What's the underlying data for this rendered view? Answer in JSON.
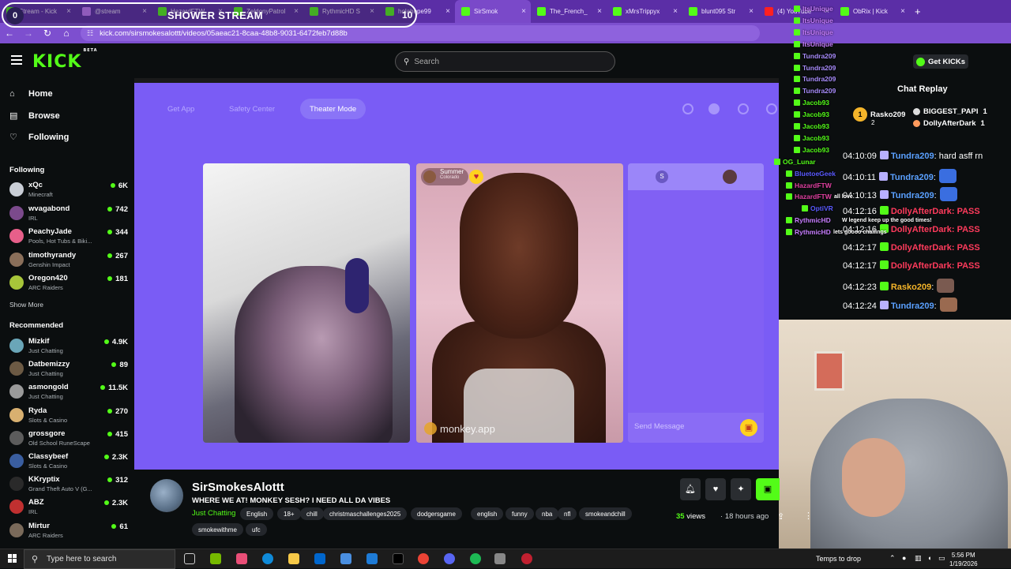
{
  "browser": {
    "tabs": [
      {
        "label": "Stream - Kick",
        "color": "#53fc18"
      },
      {
        "label": "@stream",
        "color": "#c77dff"
      },
      {
        "label": "HazardFTW",
        "color": "#53fc18"
      },
      {
        "label": "ZeldonyPatrol",
        "color": "#53fc18"
      },
      {
        "label": "RythmicHD S",
        "color": "#53fc18"
      },
      {
        "label": "holahope99",
        "color": "#53fc18"
      },
      {
        "label": "SirSmok",
        "color": "#53fc18",
        "active": true
      },
      {
        "label": "The_French_",
        "color": "#53fc18"
      },
      {
        "label": "xMrsTrippyx",
        "color": "#53fc18"
      },
      {
        "label": "blunt095 Str",
        "color": "#53fc18"
      },
      {
        "label": "(4) YouTube",
        "color": "#ff2020"
      },
      {
        "label": "ObRix | Kick",
        "color": "#53fc18"
      }
    ],
    "url": "kick.com/sirsmokesalottt/videos/05aeac21-8caa-48b8-9031-6472feb7d88b"
  },
  "overlay": {
    "count": "0",
    "title": "SHOWER STREAM",
    "number": "10"
  },
  "header": {
    "logo": "KICK",
    "logo_sup": "BETA",
    "search_placeholder": "Search",
    "get_kicks": "Get KICKs"
  },
  "sidebar": {
    "nav": [
      {
        "label": "Home",
        "icon": "home-icon",
        "glyph": "⌂"
      },
      {
        "label": "Browse",
        "icon": "browse-icon",
        "glyph": "▤"
      },
      {
        "label": "Following",
        "icon": "heart-icon",
        "glyph": "♡"
      }
    ],
    "following_title": "Following",
    "following": [
      {
        "name": "xQc",
        "category": "Minecraft",
        "viewers": "6K",
        "color": "#c9ced6"
      },
      {
        "name": "wvagabond",
        "category": "IRL",
        "viewers": "742",
        "color": "#7b4a8c"
      },
      {
        "name": "PeachyJade",
        "category": "Pools, Hot Tubs & Biki...",
        "viewers": "344",
        "color": "#e75f8a"
      },
      {
        "name": "timothyrandy",
        "category": "Genshin Impact",
        "viewers": "267",
        "color": "#8a6f5a"
      },
      {
        "name": "Oregon420",
        "category": "ARC Raiders",
        "viewers": "181",
        "color": "#a7c53a"
      }
    ],
    "show_more": "Show More",
    "recommended_title": "Recommended",
    "recommended": [
      {
        "name": "Mizkif",
        "category": "Just Chatting",
        "viewers": "4.9K",
        "color": "#6aa6b8"
      },
      {
        "name": "Datbemizzy",
        "category": "Just Chatting",
        "viewers": "89",
        "color": "#6c5a44"
      },
      {
        "name": "asmongold",
        "category": "Just Chatting",
        "viewers": "11.5K",
        "color": "#9a9a9a"
      },
      {
        "name": "Ryda",
        "category": "Slots & Casino",
        "viewers": "270",
        "color": "#d8b070"
      },
      {
        "name": "grossgore",
        "category": "Old School RuneScape",
        "viewers": "415",
        "color": "#5c5c5c"
      },
      {
        "name": "Classybeef",
        "category": "Slots & Casino",
        "viewers": "2.3K",
        "color": "#3a5ea0"
      },
      {
        "name": "KKryptix",
        "category": "Grand Theft Auto V (G...",
        "viewers": "312",
        "color": "#2a2a2a"
      },
      {
        "name": "ABZ",
        "category": "IRL",
        "viewers": "2.3K",
        "color": "#c03030"
      },
      {
        "name": "Mirtur",
        "category": "ARC Raiders",
        "viewers": "61",
        "color": "#7a6a5a"
      }
    ]
  },
  "video": {
    "get_app": "Get App",
    "safety_center": "Safety Center",
    "theater_mode": "Theater Mode",
    "match_name": "Summer",
    "match_location": "Colorado",
    "brand": "monkey.app",
    "send_message": "Send Message",
    "side_letter": "S"
  },
  "chat": {
    "title": "Chat Replay",
    "leaders": [
      {
        "rank": "1",
        "name": "Rasko209",
        "sub": "2",
        "color": "#f5b52a"
      },
      {
        "name": "BIGGEST_PAPI",
        "value": "1"
      },
      {
        "name": "DollyAfterDark",
        "value": "1",
        "color": "#ff9a5c"
      }
    ],
    "messages": [
      {
        "time": "04:10:09",
        "user": "Tundra209",
        "text": ": hard asff rn",
        "color": "#5aa0ff",
        "badge": "#b8b0ff",
        "emote": ""
      },
      {
        "time": "04:10:11",
        "user": "Tundra209",
        "text": ":",
        "color": "#5aa0ff",
        "badge": "#b8b0ff",
        "emote": "#3a6ee0"
      },
      {
        "time": "04:10:13",
        "user": "Tundra209",
        "text": ":",
        "color": "#5aa0ff",
        "badge": "#b8b0ff",
        "emote": "#3a6ee0"
      },
      {
        "time": "04:12:16",
        "user": "DollyAfterDark",
        "text": ": PASS",
        "color": "#ff3b5c",
        "badge": "#53fc18",
        "emote": ""
      },
      {
        "time": "04:12:16",
        "user": "DollyAfterDark",
        "text": ": PASS",
        "color": "#ff3b5c",
        "badge": "#53fc18",
        "emote": ""
      },
      {
        "time": "04:12:17",
        "user": "DollyAfterDark",
        "text": ": PASS",
        "color": "#ff3b5c",
        "badge": "#53fc18",
        "emote": ""
      },
      {
        "time": "04:12:17",
        "user": "DollyAfterDark",
        "text": ": PASS",
        "color": "#ff3b5c",
        "badge": "#53fc18",
        "emote": ""
      },
      {
        "time": "04:12:23",
        "user": "Rasko209",
        "text": ":",
        "color": "#f5b52a",
        "badge": "#53fc18",
        "emote": "#7a5a50"
      },
      {
        "time": "04:12:24",
        "user": "Tundra209",
        "text": ":",
        "color": "#5aa0ff",
        "badge": "#b8b0ff",
        "emote": "#9a6a50"
      }
    ],
    "overlay_notes": [
      "all love",
      "W legend keep up the good times!",
      "lets goooo challings"
    ]
  },
  "overlay_chat": [
    {
      "name": "ItsUnique",
      "color": "#c77dff"
    },
    {
      "name": "ItsUnique",
      "color": "#c77dff"
    },
    {
      "name": "ItsUnique",
      "color": "#c77dff"
    },
    {
      "name": "ItsUnique",
      "color": "#c77dff"
    },
    {
      "name": "Tundra209",
      "color": "#a78bfa"
    },
    {
      "name": "Tundra209",
      "color": "#a78bfa"
    },
    {
      "name": "Tundra209",
      "color": "#a78bfa"
    },
    {
      "name": "Tundra209",
      "color": "#a78bfa"
    },
    {
      "name": "Jacob93",
      "color": "#53fc18"
    },
    {
      "name": "Jacob93",
      "color": "#53fc18"
    },
    {
      "name": "Jacob93",
      "color": "#53fc18"
    },
    {
      "name": "Jacob93",
      "color": "#53fc18"
    },
    {
      "name": "Jacob93",
      "color": "#53fc18"
    },
    {
      "name": "OG_Lunar",
      "color": "#53fc18"
    },
    {
      "name": "BluetoeGeek",
      "color": "#5a5aff"
    },
    {
      "name": "HazardFTW",
      "color": "#e040a0"
    },
    {
      "name": "HazardFTW",
      "color": "#e040a0"
    },
    {
      "name": "OptiVR",
      "color": "#5a5aff"
    },
    {
      "name": "RythmicHD",
      "color": "#c77dff"
    },
    {
      "name": "RythmicHD",
      "color": "#c77dff"
    }
  ],
  "stream": {
    "channel": "SirSmokesAlottt",
    "title": "WHERE WE AT! MONKEY SESH? I NEED ALL DA VIBES",
    "category": "Just Chatting",
    "tags": [
      "English",
      "18+",
      "chill",
      "christmaschallenges2025",
      "dodgersgame",
      "english",
      "funny",
      "nba",
      "nfl",
      "smokeandchill",
      "smokewithme",
      "ufc"
    ],
    "views_count": "35",
    "views_label": "views",
    "ago": "18 hours ago"
  },
  "taskbar": {
    "search": "Type here to search",
    "weather": "Temps to drop",
    "time": "5:56 PM",
    "date": "1/19/2026"
  }
}
